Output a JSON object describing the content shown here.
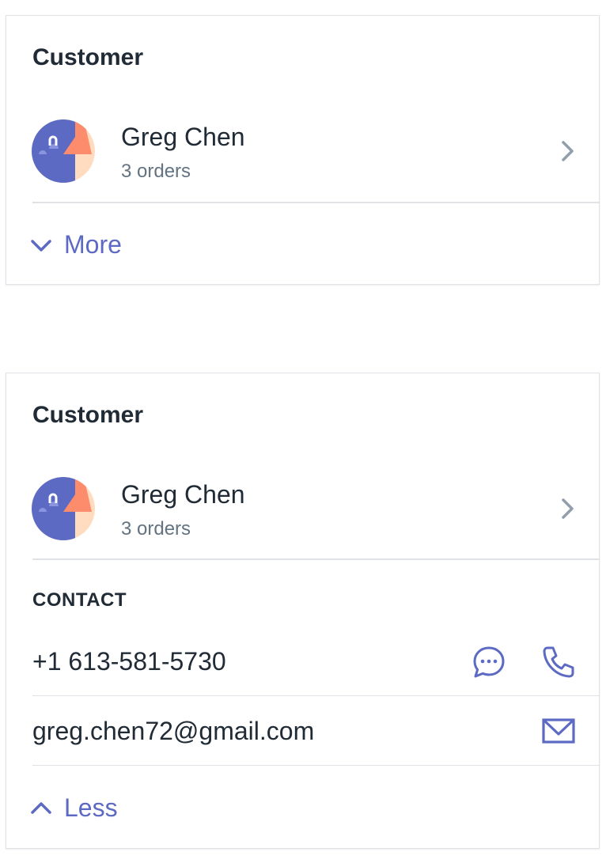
{
  "collapsed_card": {
    "title": "Customer",
    "customer": {
      "name": "Greg Chen",
      "orders": "3 orders"
    },
    "toggle_label": "More"
  },
  "expanded_card": {
    "title": "Customer",
    "customer": {
      "name": "Greg Chen",
      "orders": "3 orders"
    },
    "contact": {
      "section_label": "CONTACT",
      "phone": "+1 613-581-5730",
      "email": "greg.chen72@gmail.com"
    },
    "toggle_label": "Less"
  },
  "icons": {
    "avatar": "avatar-illustration",
    "row_chevron": "chevron-right-icon",
    "more_toggle": "chevron-down-icon",
    "less_toggle": "chevron-up-icon",
    "message": "message-icon",
    "phone": "phone-icon",
    "email": "mail-icon"
  },
  "colors": {
    "accent": "#5c6ac4",
    "text": "#212b36",
    "subdued": "#637381",
    "border": "#dfe3e8",
    "avatar_peach": "#ffdcbf",
    "avatar_salmon": "#fc8c6b"
  }
}
